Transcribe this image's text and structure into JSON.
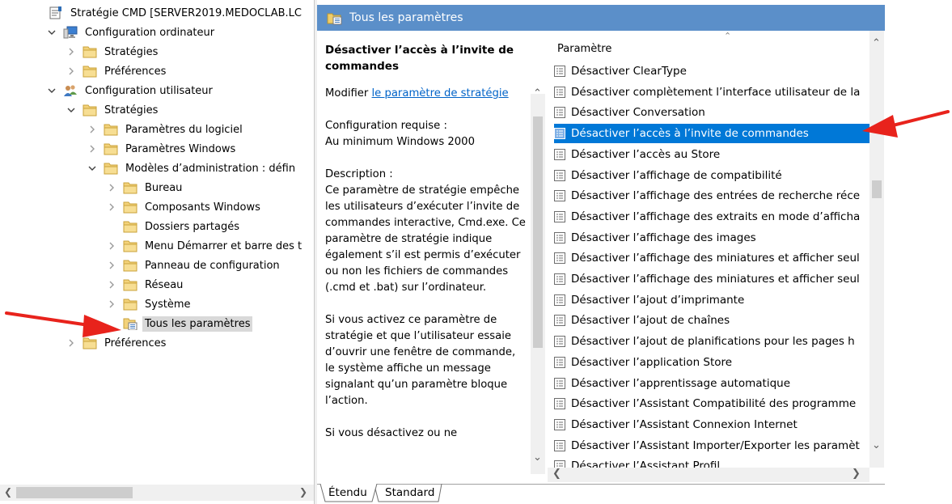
{
  "tree": {
    "items": [
      {
        "label": "Stratégie CMD [SERVER2019.MEDOCLAB.LC",
        "level": 0,
        "chevron": "none",
        "icon": "policy-icon"
      },
      {
        "label": "Configuration ordinateur",
        "level": 0,
        "chevron": "down",
        "icon": "computer-icon"
      },
      {
        "label": "Stratégies",
        "level": 1,
        "chevron": "right",
        "icon": "folder-icon"
      },
      {
        "label": "Préférences",
        "level": 1,
        "chevron": "right",
        "icon": "folder-icon"
      },
      {
        "label": "Configuration utilisateur",
        "level": 0,
        "chevron": "down",
        "icon": "users-icon"
      },
      {
        "label": "Stratégies",
        "level": 1,
        "chevron": "down",
        "icon": "folder-icon"
      },
      {
        "label": "Paramètres du logiciel",
        "level": 2,
        "chevron": "right",
        "icon": "folder-icon"
      },
      {
        "label": "Paramètres Windows",
        "level": 2,
        "chevron": "right",
        "icon": "folder-icon"
      },
      {
        "label": "Modèles d’administration : défin",
        "level": 2,
        "chevron": "down",
        "icon": "folder-icon"
      },
      {
        "label": "Bureau",
        "level": 3,
        "chevron": "right",
        "icon": "folder-icon"
      },
      {
        "label": "Composants Windows",
        "level": 3,
        "chevron": "right",
        "icon": "folder-icon"
      },
      {
        "label": "Dossiers partagés",
        "level": 3,
        "chevron": "none",
        "icon": "folder-icon"
      },
      {
        "label": "Menu Démarrer et barre des t",
        "level": 3,
        "chevron": "right",
        "icon": "folder-icon"
      },
      {
        "label": "Panneau de configuration",
        "level": 3,
        "chevron": "right",
        "icon": "folder-icon"
      },
      {
        "label": "Réseau",
        "level": 3,
        "chevron": "right",
        "icon": "folder-icon"
      },
      {
        "label": "Système",
        "level": 3,
        "chevron": "right",
        "icon": "folder-icon"
      },
      {
        "label": "Tous les paramètres",
        "level": 3,
        "chevron": "none",
        "icon": "all-settings-icon",
        "selected": true
      },
      {
        "label": "Préférences",
        "level": 1,
        "chevron": "right",
        "icon": "folder-icon"
      }
    ]
  },
  "header": {
    "title": "Tous les paramètres",
    "icon": "all-settings-icon"
  },
  "description": {
    "title": "Désactiver l’accès à l’invite de commandes",
    "edit_prefix": "Modifier ",
    "edit_link": "le paramètre de stratégie",
    "requirements_label": "Configuration requise :",
    "requirements_value": "Au minimum Windows 2000",
    "description_label": "Description :",
    "description_text": "Ce paramètre de stratégie empêche les utilisateurs d’exécuter l’invite de commandes interactive, Cmd.exe.  Ce paramètre de stratégie indique également s’il est permis d’exécuter ou non les fichiers de commandes (.cmd et .bat) sur l’ordinateur.",
    "enabled_text": "Si vous activez ce paramètre de stratégie et que l’utilisateur essaie d’ouvrir une fenêtre de commande, le système affiche un message signalant qu’un paramètre bloque l’action.",
    "disabled_text": "Si vous désactivez ou ne"
  },
  "list": {
    "column_header": "Paramètre",
    "items": [
      {
        "label": "Désactiver ClearType"
      },
      {
        "label": "Désactiver complètement l’interface utilisateur de la"
      },
      {
        "label": "Désactiver Conversation"
      },
      {
        "label": "Désactiver l’accès à l’invite de commandes",
        "selected": true
      },
      {
        "label": "Désactiver l’accès au Store"
      },
      {
        "label": "Désactiver l’affichage de compatibilité"
      },
      {
        "label": "Désactiver l’affichage des entrées de recherche réce"
      },
      {
        "label": "Désactiver l’affichage des extraits en mode d’afficha"
      },
      {
        "label": "Désactiver l’affichage des images"
      },
      {
        "label": "Désactiver l’affichage des miniatures et afficher seul"
      },
      {
        "label": "Désactiver l’affichage des miniatures et afficher seul"
      },
      {
        "label": "Désactiver l’ajout d’imprimante"
      },
      {
        "label": "Désactiver l’ajout de chaînes"
      },
      {
        "label": "Désactiver l’ajout de planifications pour les pages h"
      },
      {
        "label": "Désactiver l’application Store"
      },
      {
        "label": "Désactiver l’apprentissage automatique"
      },
      {
        "label": "Désactiver l’Assistant Compatibilité des programme"
      },
      {
        "label": "Désactiver l’Assistant Connexion Internet"
      },
      {
        "label": "Désactiver l’Assistant Importer/Exporter les paramèt"
      },
      {
        "label": "Désactiver l’Assistant Profil"
      }
    ]
  },
  "tabs": [
    {
      "label": "Étendu",
      "active": true
    },
    {
      "label": "Standard",
      "active": false
    }
  ],
  "colors": {
    "header_bg": "#5b8fc9",
    "selection": "#0078d7",
    "link": "#0063c8",
    "arrow": "#e8231c",
    "folder": "#e8c35a"
  }
}
